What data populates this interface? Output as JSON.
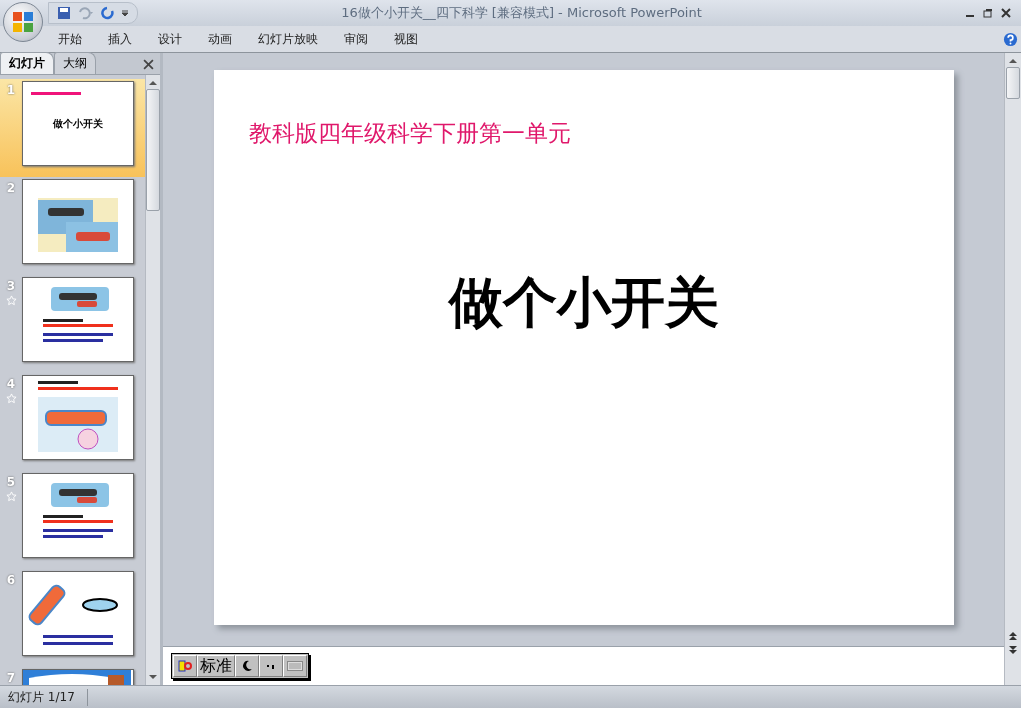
{
  "window": {
    "title": "16做个小开关__四下科学 [兼容模式] - Microsoft PowerPoint"
  },
  "ribbon_tabs": [
    {
      "label": "开始",
      "selected": false
    },
    {
      "label": "插入",
      "selected": false
    },
    {
      "label": "设计",
      "selected": false
    },
    {
      "label": "动画",
      "selected": false
    },
    {
      "label": "幻灯片放映",
      "selected": false
    },
    {
      "label": "审阅",
      "selected": false
    },
    {
      "label": "视图",
      "selected": false
    }
  ],
  "panel_tabs": [
    {
      "label": "幻灯片",
      "selected": true
    },
    {
      "label": "大纲",
      "selected": false
    }
  ],
  "slides": [
    {
      "number": "1",
      "selected": true,
      "animated": false,
      "kind": "title",
      "title": "做个小开关"
    },
    {
      "number": "2",
      "selected": false,
      "animated": false,
      "kind": "photo"
    },
    {
      "number": "3",
      "selected": false,
      "animated": true,
      "kind": "photo-text"
    },
    {
      "number": "4",
      "selected": false,
      "animated": true,
      "kind": "diagram"
    },
    {
      "number": "5",
      "selected": false,
      "animated": true,
      "kind": "photo-text"
    },
    {
      "number": "6",
      "selected": false,
      "animated": false,
      "kind": "diagram-bubble"
    },
    {
      "number": "7",
      "selected": false,
      "animated": false,
      "kind": "cartoon"
    }
  ],
  "slide": {
    "subtitle": "教科版四年级科学下册第一单元",
    "title": "做个小开关"
  },
  "ime_bar": {
    "mode": "标准"
  },
  "status_bar": {
    "slide_counter": "幻灯片 1/17"
  }
}
